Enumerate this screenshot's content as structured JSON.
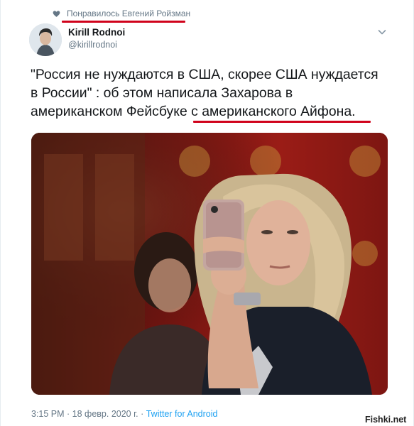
{
  "social_context": {
    "text": "Понравилось Евгений Ройзман",
    "icon": "heart-icon",
    "underline_color": "#d0021b"
  },
  "author": {
    "name": "Kirill Rodnoi",
    "handle": "@kirillrodnoi",
    "avatar": "avatar-photo"
  },
  "tweet": {
    "text_before": "\"Россия не нуждаются в США, скорее США нуждается в России\" : об этом написала Захарова в американском Фейсбуке ",
    "text_highlight": "с американского Айфона."
  },
  "photo": {
    "description_icon": "photo-image"
  },
  "meta": {
    "time": "3:15 PM",
    "separator1": " · ",
    "date": "18 февр. 2020 г.",
    "separator2": " · ",
    "source": "Twitter for Android"
  },
  "watermark": {
    "text": "Fishki.net"
  },
  "colors": {
    "text_primary": "#14171a",
    "text_secondary": "#657786",
    "link": "#1da1f2",
    "highlight_underline": "#d0021b"
  }
}
